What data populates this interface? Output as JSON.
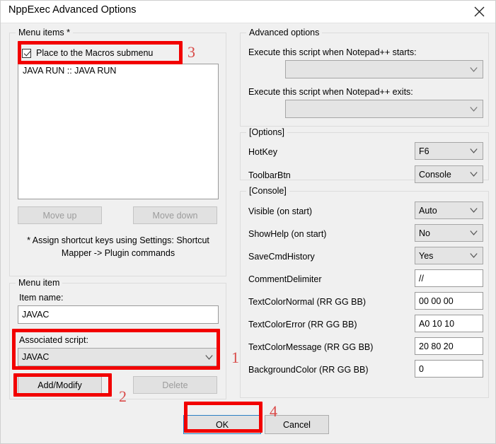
{
  "window": {
    "title": "NppExec Advanced Options",
    "close_icon": "close-icon"
  },
  "menu_items_group": {
    "legend": "Menu items *",
    "place_macros_checkbox": {
      "label": "Place to the Macros submenu",
      "checked": true
    },
    "list": {
      "items": [
        "JAVA RUN :: JAVA RUN"
      ]
    },
    "move_up_label": "Move up",
    "move_down_label": "Move down",
    "hint_line1": "* Assign shortcut keys using Settings:  Shortcut",
    "hint_line2": "Mapper -> Plugin commands"
  },
  "menu_item_group": {
    "legend": "Menu item",
    "item_name_label": "Item name:",
    "item_name_value": "JAVAC",
    "associated_script_label": "Associated script:",
    "associated_script_value": "JAVAC",
    "add_modify_label": "Add/Modify",
    "delete_label": "Delete"
  },
  "advanced_group": {
    "legend": "Advanced options",
    "on_start_label": "Execute this script when Notepad++ starts:",
    "on_start_value": "",
    "on_exit_label": "Execute this script when Notepad++ exits:",
    "on_exit_value": ""
  },
  "options_group": {
    "legend": "[Options]",
    "rows": [
      {
        "label": "HotKey",
        "value": "F6",
        "kind": "combo"
      },
      {
        "label": "ToolbarBtn",
        "value": "Console",
        "kind": "combo"
      }
    ]
  },
  "console_group": {
    "legend": "[Console]",
    "rows": [
      {
        "label": "Visible (on start)",
        "value": "Auto",
        "kind": "combo"
      },
      {
        "label": "ShowHelp (on start)",
        "value": "No",
        "kind": "combo"
      },
      {
        "label": "SaveCmdHistory",
        "value": "Yes",
        "kind": "combo"
      },
      {
        "label": "CommentDelimiter",
        "value": "//",
        "kind": "text"
      },
      {
        "label": "TextColorNormal (RR GG BB)",
        "value": "00 00 00",
        "kind": "text"
      },
      {
        "label": "TextColorError (RR GG BB)",
        "value": "A0 10 10",
        "kind": "text"
      },
      {
        "label": "TextColorMessage (RR GG BB)",
        "value": "20 80 20",
        "kind": "text"
      },
      {
        "label": "BackgroundColor (RR GG BB)",
        "value": "0",
        "kind": "text"
      }
    ]
  },
  "footer": {
    "ok_label": "OK",
    "cancel_label": "Cancel"
  },
  "annotations": {
    "color": "#f20000",
    "number_color": "#d94a48",
    "steps": [
      {
        "id": "1",
        "target": "associated-script"
      },
      {
        "id": "2",
        "target": "add-modify-button"
      },
      {
        "id": "3",
        "target": "place-macros-checkbox"
      },
      {
        "id": "4",
        "target": "ok-button"
      }
    ]
  }
}
